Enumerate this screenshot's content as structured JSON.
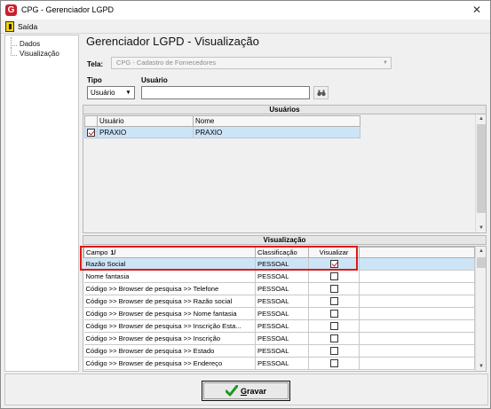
{
  "window": {
    "title": "CPG - Gerenciador LGPD",
    "app_icon_letter": "G"
  },
  "menu": {
    "exit_label": "Saída"
  },
  "tree": {
    "items": [
      {
        "label": "Dados"
      },
      {
        "label": "Visualização"
      }
    ]
  },
  "form": {
    "page_title": "Gerenciador LGPD - Visualização",
    "tela_label": "Tela:",
    "tela_value": "CPG - Cadastro de Fornecedores",
    "tipo_label": "Tipo",
    "tipo_value": "Usuário",
    "usuario_label": "Usuário",
    "usuario_value": ""
  },
  "users": {
    "header": "Usuários",
    "columns": [
      "Usuário",
      "Nome"
    ],
    "rows": [
      {
        "checked": true,
        "usuario": "PRAXIO",
        "nome": "PRAXIO"
      }
    ]
  },
  "visualizacao": {
    "header": "Visualização",
    "columns": {
      "campo": "Campo",
      "sort_indicator": "1/",
      "classificacao": "Classificação",
      "visualizar": "Visualizar"
    },
    "rows": [
      {
        "campo": "Razão Social",
        "classificacao": "PESSOAL",
        "visualizar": true
      },
      {
        "campo": "Nome fantasia",
        "classificacao": "PESSOAL",
        "visualizar": false
      },
      {
        "campo": "Código >> Browser de pesquisa >> Telefone",
        "classificacao": "PESSOAL",
        "visualizar": false
      },
      {
        "campo": "Código >> Browser de pesquisa >> Razão social",
        "classificacao": "PESSOAL",
        "visualizar": false
      },
      {
        "campo": "Código >> Browser de pesquisa >> Nome fantasia",
        "classificacao": "PESSOAL",
        "visualizar": false
      },
      {
        "campo": "Código >> Browser de pesquisa >> Inscrição Esta...",
        "classificacao": "PESSOAL",
        "visualizar": false
      },
      {
        "campo": "Código >> Browser de pesquisa >> Inscrição",
        "classificacao": "PESSOAL",
        "visualizar": false
      },
      {
        "campo": "Código >> Browser de pesquisa >> Estado",
        "classificacao": "PESSOAL",
        "visualizar": false
      },
      {
        "campo": "Código >> Browser de pesquisa >> Endereço",
        "classificacao": "PESSOAL",
        "visualizar": false
      }
    ]
  },
  "actions": {
    "save_label_first": "G",
    "save_label_rest": "ravar"
  },
  "colors": {
    "selection": "#cde4f7",
    "highlight": "#e01818",
    "check": "#d01a1a",
    "save_check": "#1a9a1a",
    "app_icon": "#c8202b"
  }
}
